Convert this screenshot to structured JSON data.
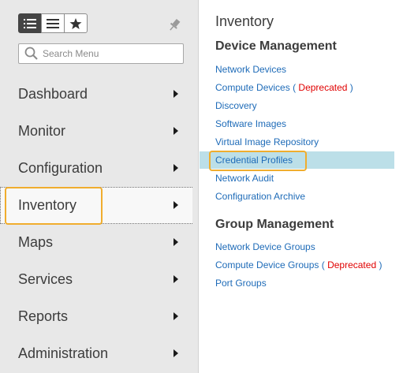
{
  "sidebar": {
    "search_placeholder": "Search Menu",
    "items": [
      {
        "label": "Dashboard"
      },
      {
        "label": "Monitor"
      },
      {
        "label": "Configuration"
      },
      {
        "label": "Inventory",
        "active": true
      },
      {
        "label": "Maps"
      },
      {
        "label": "Services"
      },
      {
        "label": "Reports"
      },
      {
        "label": "Administration"
      }
    ]
  },
  "flyout": {
    "title": "Inventory",
    "device_management": {
      "heading": "Device Management",
      "links": [
        {
          "label": "Network Devices"
        },
        {
          "label": "Compute Devices",
          "open": "(",
          "note": "Deprecated",
          "close": ")"
        },
        {
          "label": "Discovery"
        },
        {
          "label": "Software Images"
        },
        {
          "label": "Virtual Image Repository"
        },
        {
          "label": "Credential Profiles",
          "selected": true
        },
        {
          "label": "Network Audit"
        },
        {
          "label": "Configuration Archive"
        }
      ]
    },
    "group_management": {
      "heading": "Group Management",
      "links": [
        {
          "label": "Network Device Groups"
        },
        {
          "label": "Compute Device Groups",
          "open": "(",
          "note": "Deprecated",
          "close": ")"
        },
        {
          "label": "Port Groups"
        }
      ]
    }
  },
  "colors": {
    "highlight_outline": "#f0ad2e",
    "link": "#1e6bb8",
    "deprecated": "#e00000",
    "selected_row": "#bcdfe8"
  },
  "icons": [
    "list-view-icon",
    "detail-view-icon",
    "favorites-star-icon",
    "pin-icon",
    "search-icon",
    "chevron-right-icon"
  ]
}
